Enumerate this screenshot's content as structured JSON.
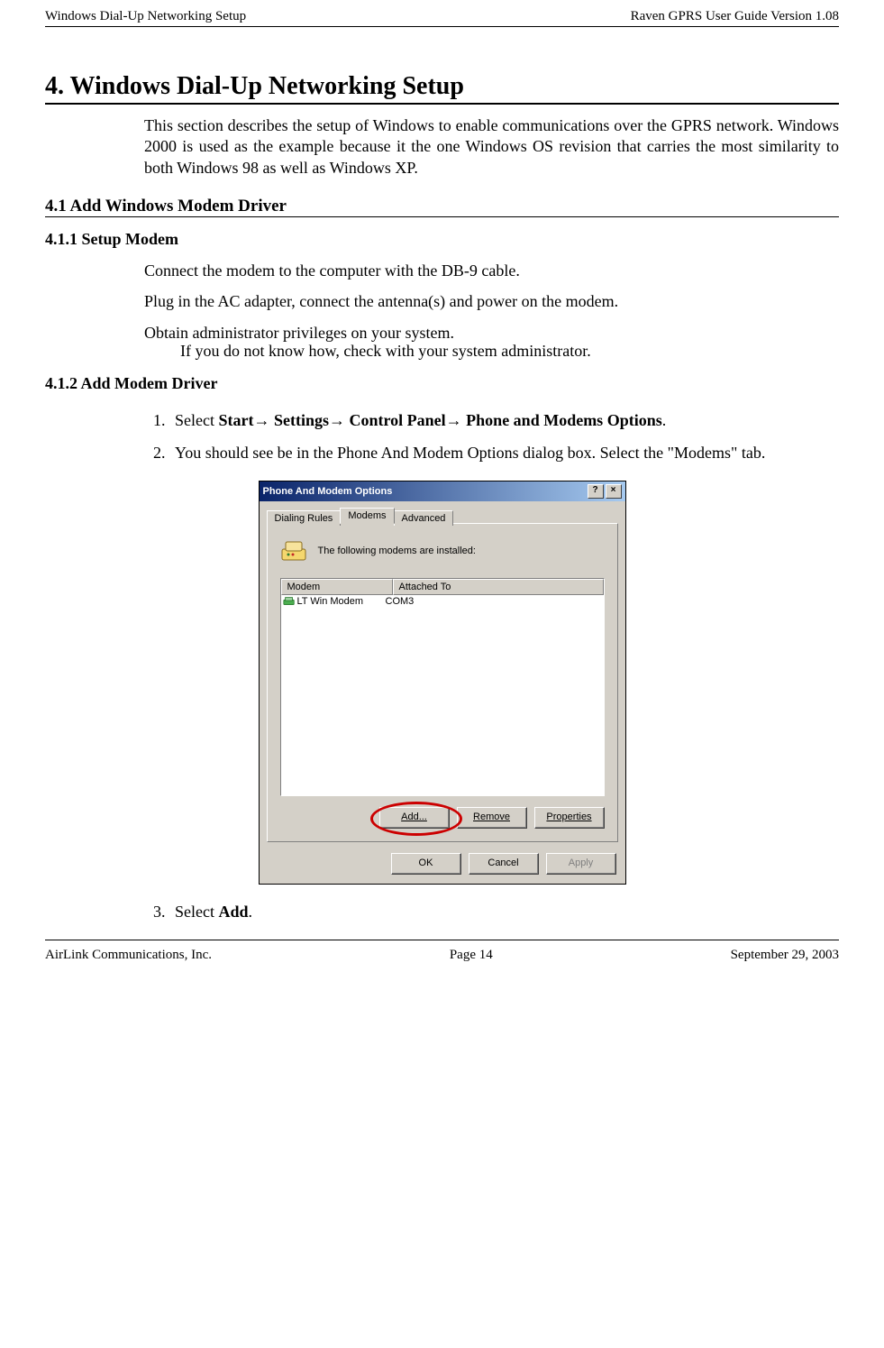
{
  "header": {
    "left": "Windows Dial-Up Networking Setup",
    "right": "Raven GPRS User Guide Version 1.08"
  },
  "section": {
    "number_title": "4.  Windows Dial-Up Networking Setup",
    "intro": "This section describes the setup of Windows to enable communications over the GPRS network. Windows 2000 is used as the example because it the one Windows OS revision that carries the most similarity to both Windows 98 as well as Windows XP."
  },
  "sub41": {
    "title": "4.1   Add Windows Modem Driver"
  },
  "sub411": {
    "title": "4.1.1   Setup Modem",
    "p1": "Connect the modem to the computer with the DB-9 cable.",
    "p2": "Plug in the AC adapter, connect the antenna(s) and power on the modem.",
    "p3": "Obtain administrator privileges on your system.",
    "p3sub": "If you do not know how, check with your system administrator."
  },
  "sub412": {
    "title": "4.1.2   Add Modem Driver",
    "step1_pre": "Select ",
    "step1_b1": "Start",
    "step1_arrow": "→",
    "step1_b2": " Settings",
    "step1_b3": " Control Panel",
    "step1_b4": " Phone and Modems Options",
    "step1_post": ".",
    "step2": "You should see be in the Phone And Modem Options dialog box. Select the \"Modems\" tab.",
    "step3_pre": "Select ",
    "step3_b": "Add",
    "step3_post": "."
  },
  "dialog": {
    "title": "Phone And Modem Options",
    "help_btn": "?",
    "close_btn": "×",
    "tabs": {
      "dialing": "Dialing Rules",
      "modems": "Modems",
      "advanced": "Advanced"
    },
    "label": "The following modems are  installed:",
    "columns": {
      "modem": "Modem",
      "attached": "Attached To"
    },
    "row": {
      "modem": "LT Win Modem",
      "attached": "COM3"
    },
    "buttons": {
      "add": "Add...",
      "remove": "Remove",
      "properties": "Properties",
      "ok": "OK",
      "cancel": "Cancel",
      "apply": "Apply"
    }
  },
  "footer": {
    "left": "AirLink Communications, Inc.",
    "center": "Page 14",
    "right": "September 29, 2003"
  }
}
